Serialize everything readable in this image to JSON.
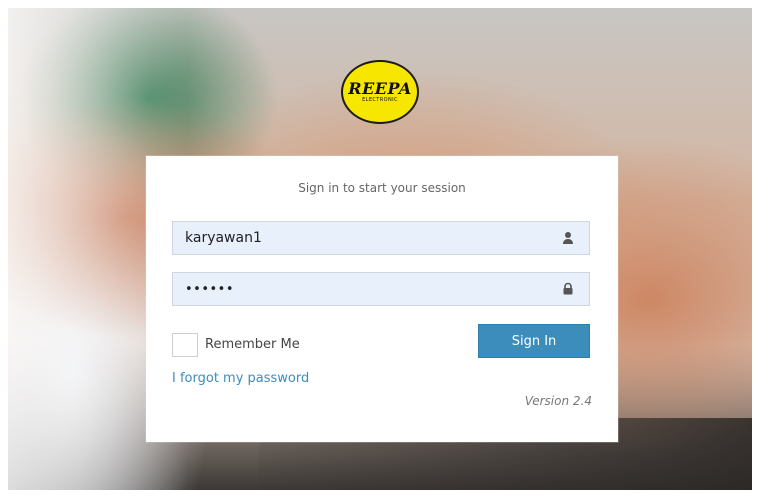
{
  "logo": {
    "main_text": "REEPA",
    "sub_text": "ELECTRONIC",
    "icon_name": "brand-logo-icon"
  },
  "login": {
    "headline": "Sign in to start your session",
    "username": {
      "value": "karyawan1",
      "icon_name": "user-icon"
    },
    "password": {
      "value": "••••••",
      "icon_name": "lock-icon"
    },
    "remember_me_label": "Remember Me",
    "sign_in_label": "Sign In",
    "forgot_password_label": "I forgot my password",
    "version_text": "Version 2.4"
  },
  "colors": {
    "primary_button": "#3c8dbc",
    "input_background": "#e8f0fb",
    "logo_yellow": "#f7e600"
  }
}
